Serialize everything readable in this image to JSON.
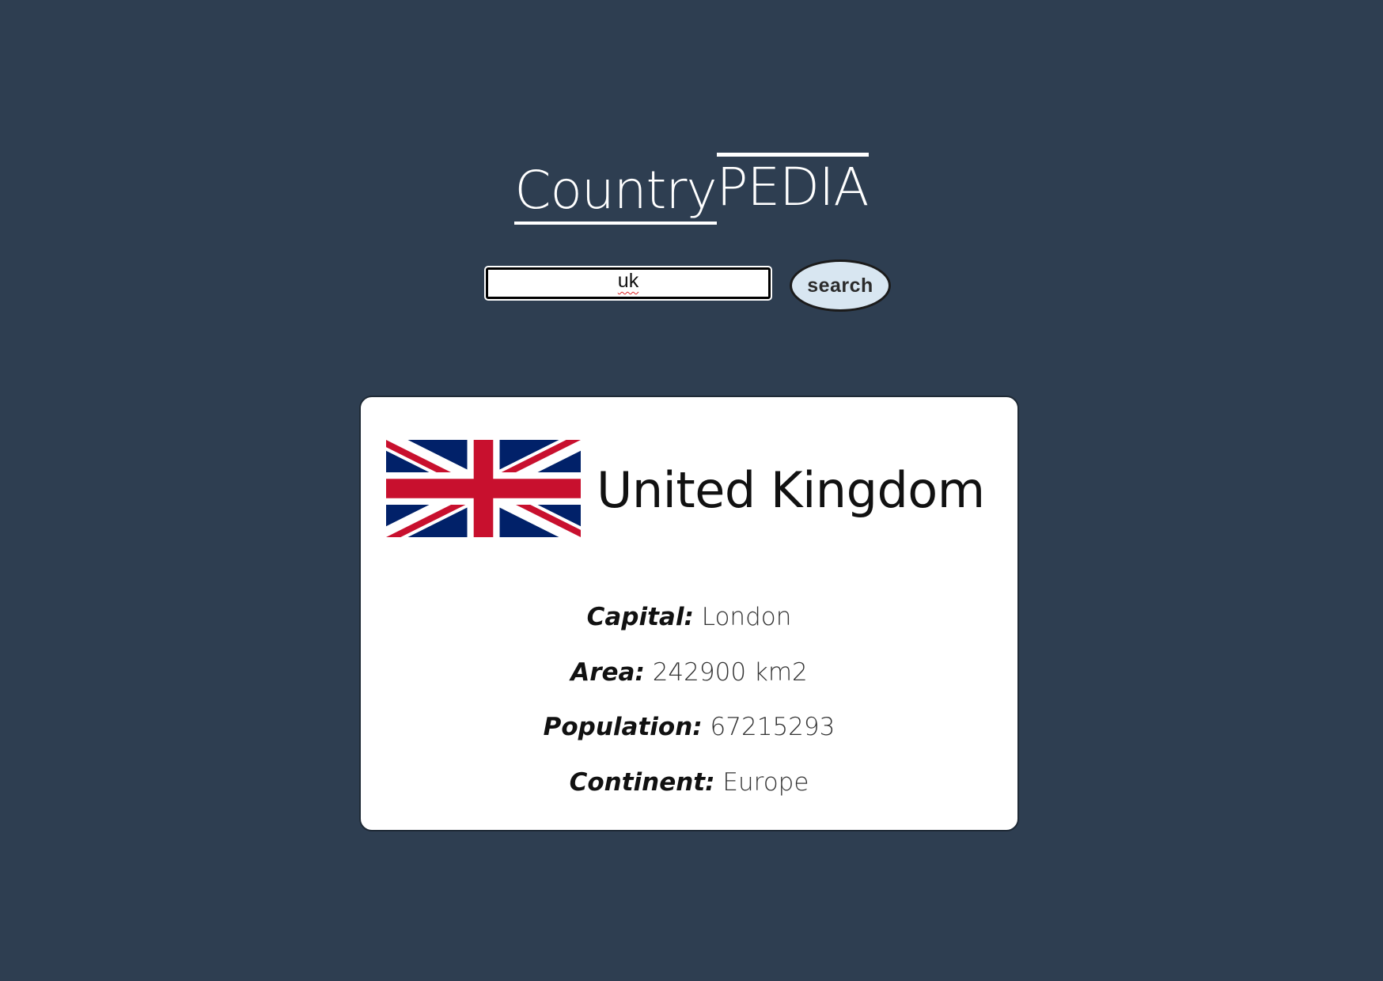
{
  "logo": {
    "part_a": "Country",
    "part_b": "PEDIA"
  },
  "search": {
    "value": "uk",
    "button_label": "search"
  },
  "result": {
    "country_name": "United Kingdom",
    "flag_icon": "union-jack-flag",
    "facts": [
      {
        "label": "Capital:",
        "value": "London"
      },
      {
        "label": "Area:",
        "value": "242900 km2"
      },
      {
        "label": "Population:",
        "value": "67215293"
      },
      {
        "label": "Continent:",
        "value": "Europe"
      }
    ]
  },
  "colors": {
    "background": "#2e3e51",
    "card": "#ffffff",
    "button": "#d8e6f1",
    "flag_blue": "#012169",
    "flag_red": "#c8102e"
  }
}
